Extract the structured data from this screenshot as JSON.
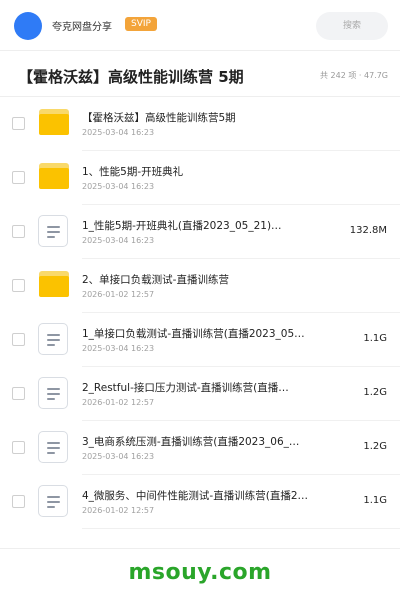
{
  "header": {
    "username": "夸克网盘分享",
    "badge": "SVIP",
    "search_placeholder": "搜索"
  },
  "folder": {
    "title": "【霍格沃兹】高级性能训练营 5期",
    "stats": "共 242 项 · 47.7G"
  },
  "items": [
    {
      "type": "folder",
      "name": "【霍格沃兹】高级性能训练营5期",
      "date": "2025-03-04 16:23",
      "size": ""
    },
    {
      "type": "folder",
      "name": "1、性能5期-开班典礼",
      "date": "2025-03-04 16:23",
      "size": ""
    },
    {
      "type": "file",
      "name": "1_性能5期-开班典礼(直播2023_05_21)…",
      "date": "2025-03-04 16:23",
      "size": "132.8M"
    },
    {
      "type": "folder",
      "name": "2、单接口负载测试-直播训练营",
      "date": "2026-01-02 12:57",
      "size": ""
    },
    {
      "type": "file",
      "name": "1_单接口负载测试-直播训练营(直播2023_05…",
      "date": "2025-03-04 16:23",
      "size": "1.1G"
    },
    {
      "type": "file",
      "name": "2_Restful-接口压力测试-直播训练营(直播…",
      "date": "2026-01-02 12:57",
      "size": "1.2G"
    },
    {
      "type": "file",
      "name": "3_电商系统压测-直播训练营(直播2023_06_…",
      "date": "2025-03-04 16:23",
      "size": "1.2G"
    },
    {
      "type": "file",
      "name": "4_微服务、中间件性能测试-直播训练营(直播202…",
      "date": "2026-01-02 12:57",
      "size": "1.1G"
    }
  ],
  "watermark": "msouy.com",
  "icons": {
    "folder": "folder-icon",
    "file": "document-icon"
  },
  "colors": {
    "accent": "#2f7bf6",
    "svip": "#f3a43a",
    "folder": "#fbc200",
    "watermark": "#2aa52a"
  }
}
